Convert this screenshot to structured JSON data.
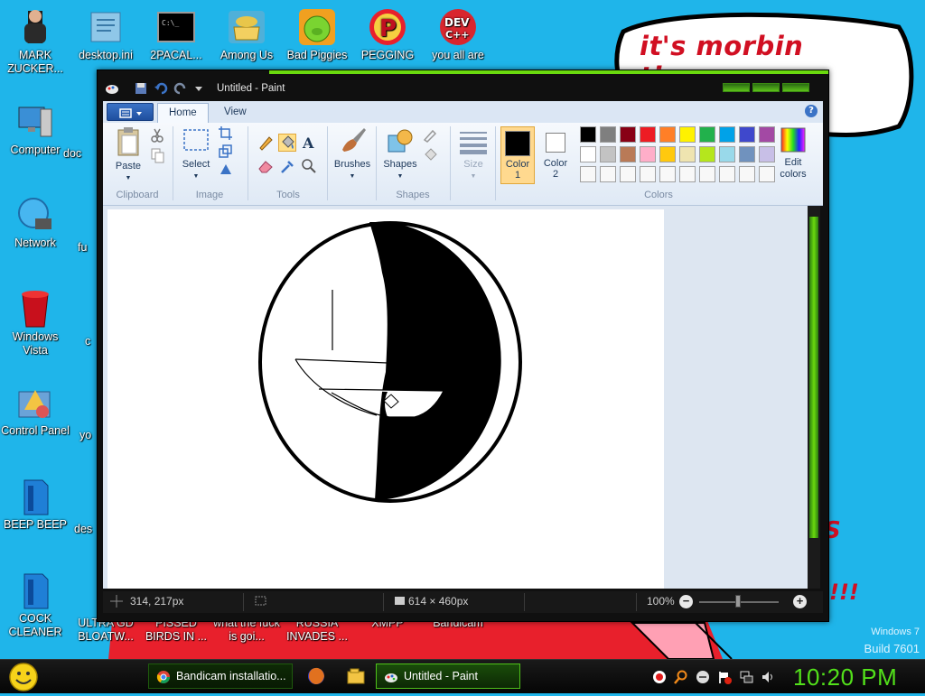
{
  "wallpaper": {
    "speech_text": "it's morbin time",
    "os_watermark": "Windows 7",
    "build_watermark": "Build 7601"
  },
  "desktop": {
    "icons_col1": [
      {
        "label": "MARK ZUCKER...",
        "icon": "person-icon"
      },
      {
        "label": "Computer",
        "icon": "computer-icon"
      },
      {
        "label": "Network",
        "icon": "network-globe-icon"
      },
      {
        "label": "Windows Vista",
        "icon": "recycle-bin-icon"
      },
      {
        "label": "Control Panel",
        "icon": "control-panel-icon"
      },
      {
        "label": "BEEP BEEP",
        "icon": "blue-file-icon"
      },
      {
        "label": "COCK CLEANER",
        "icon": "blue-file-icon"
      }
    ],
    "icons_row1": [
      {
        "label": "desktop.ini",
        "icon": "ini-file-icon"
      },
      {
        "label": "2PACAL...",
        "icon": "console-icon"
      },
      {
        "label": "Among Us",
        "icon": "folder-shortcut-icon"
      },
      {
        "label": "Bad Piggies",
        "icon": "bad-piggies-icon"
      },
      {
        "label": "PEGGING",
        "icon": "p-logo-icon"
      },
      {
        "label": "you all are",
        "icon": "dev-cpp-icon"
      }
    ],
    "icons_bottom_row": [
      {
        "label": "ULTRA GD BLOATW..."
      },
      {
        "label": "PISSED BIRDS IN ..."
      },
      {
        "label": "what the fuck is goi..."
      },
      {
        "label": "RUSSIA INVADES ..."
      },
      {
        "label": "XMPP"
      },
      {
        "label": "Bandicam"
      }
    ],
    "partial_labels": {
      "doc": "doc",
      "fu": "fu",
      "c": "c",
      "yo": "yo",
      "des": "des"
    }
  },
  "paint": {
    "title": "Untitled - Paint",
    "tabs": [
      {
        "label": "Home",
        "active": true
      },
      {
        "label": "View",
        "active": false
      }
    ],
    "help": "?",
    "groups": {
      "clipboard": "Clipboard",
      "image": "Image",
      "tools": "Tools",
      "shapes": "Shapes",
      "colors": "Colors"
    },
    "buttons": {
      "paste": "Paste",
      "select": "Select",
      "brushes": "Brushes",
      "shapes": "Shapes",
      "size": "Size",
      "color1_a": "Color",
      "color1_b": "1",
      "color2_a": "Color",
      "color2_b": "2",
      "edit_a": "Edit",
      "edit_b": "colors"
    },
    "selected_tool": "fill-bucket",
    "color1": "#000000",
    "color2": "#ffffff",
    "palette": [
      "#000000",
      "#7f7f7f",
      "#880015",
      "#ed1c24",
      "#ff7f27",
      "#fff200",
      "#22b14c",
      "#00a2e8",
      "#3f48cc",
      "#a349a4",
      "#ffffff",
      "#c3c3c3",
      "#b97a57",
      "#ffaec9",
      "#ffc90e",
      "#efe4b0",
      "#b5e61d",
      "#99d9ea",
      "#7092be",
      "#c8bfe7",
      "#f8f8f8",
      "#f8f8f8",
      "#f8f8f8",
      "#f8f8f8",
      "#f8f8f8",
      "#f8f8f8",
      "#f8f8f8",
      "#f8f8f8",
      "#f8f8f8",
      "#f8f8f8"
    ],
    "status": {
      "cursor_pos": "314, 217px",
      "canvas_size": "614 × 460px",
      "zoom": "100%"
    }
  },
  "taskbar": {
    "buttons": [
      {
        "label": "Bandicam installatio...",
        "active": false,
        "icon": "chrome-icon"
      },
      {
        "label": "Untitled - Paint",
        "active": true,
        "icon": "paint-icon"
      }
    ],
    "clock": "10:20 PM"
  }
}
